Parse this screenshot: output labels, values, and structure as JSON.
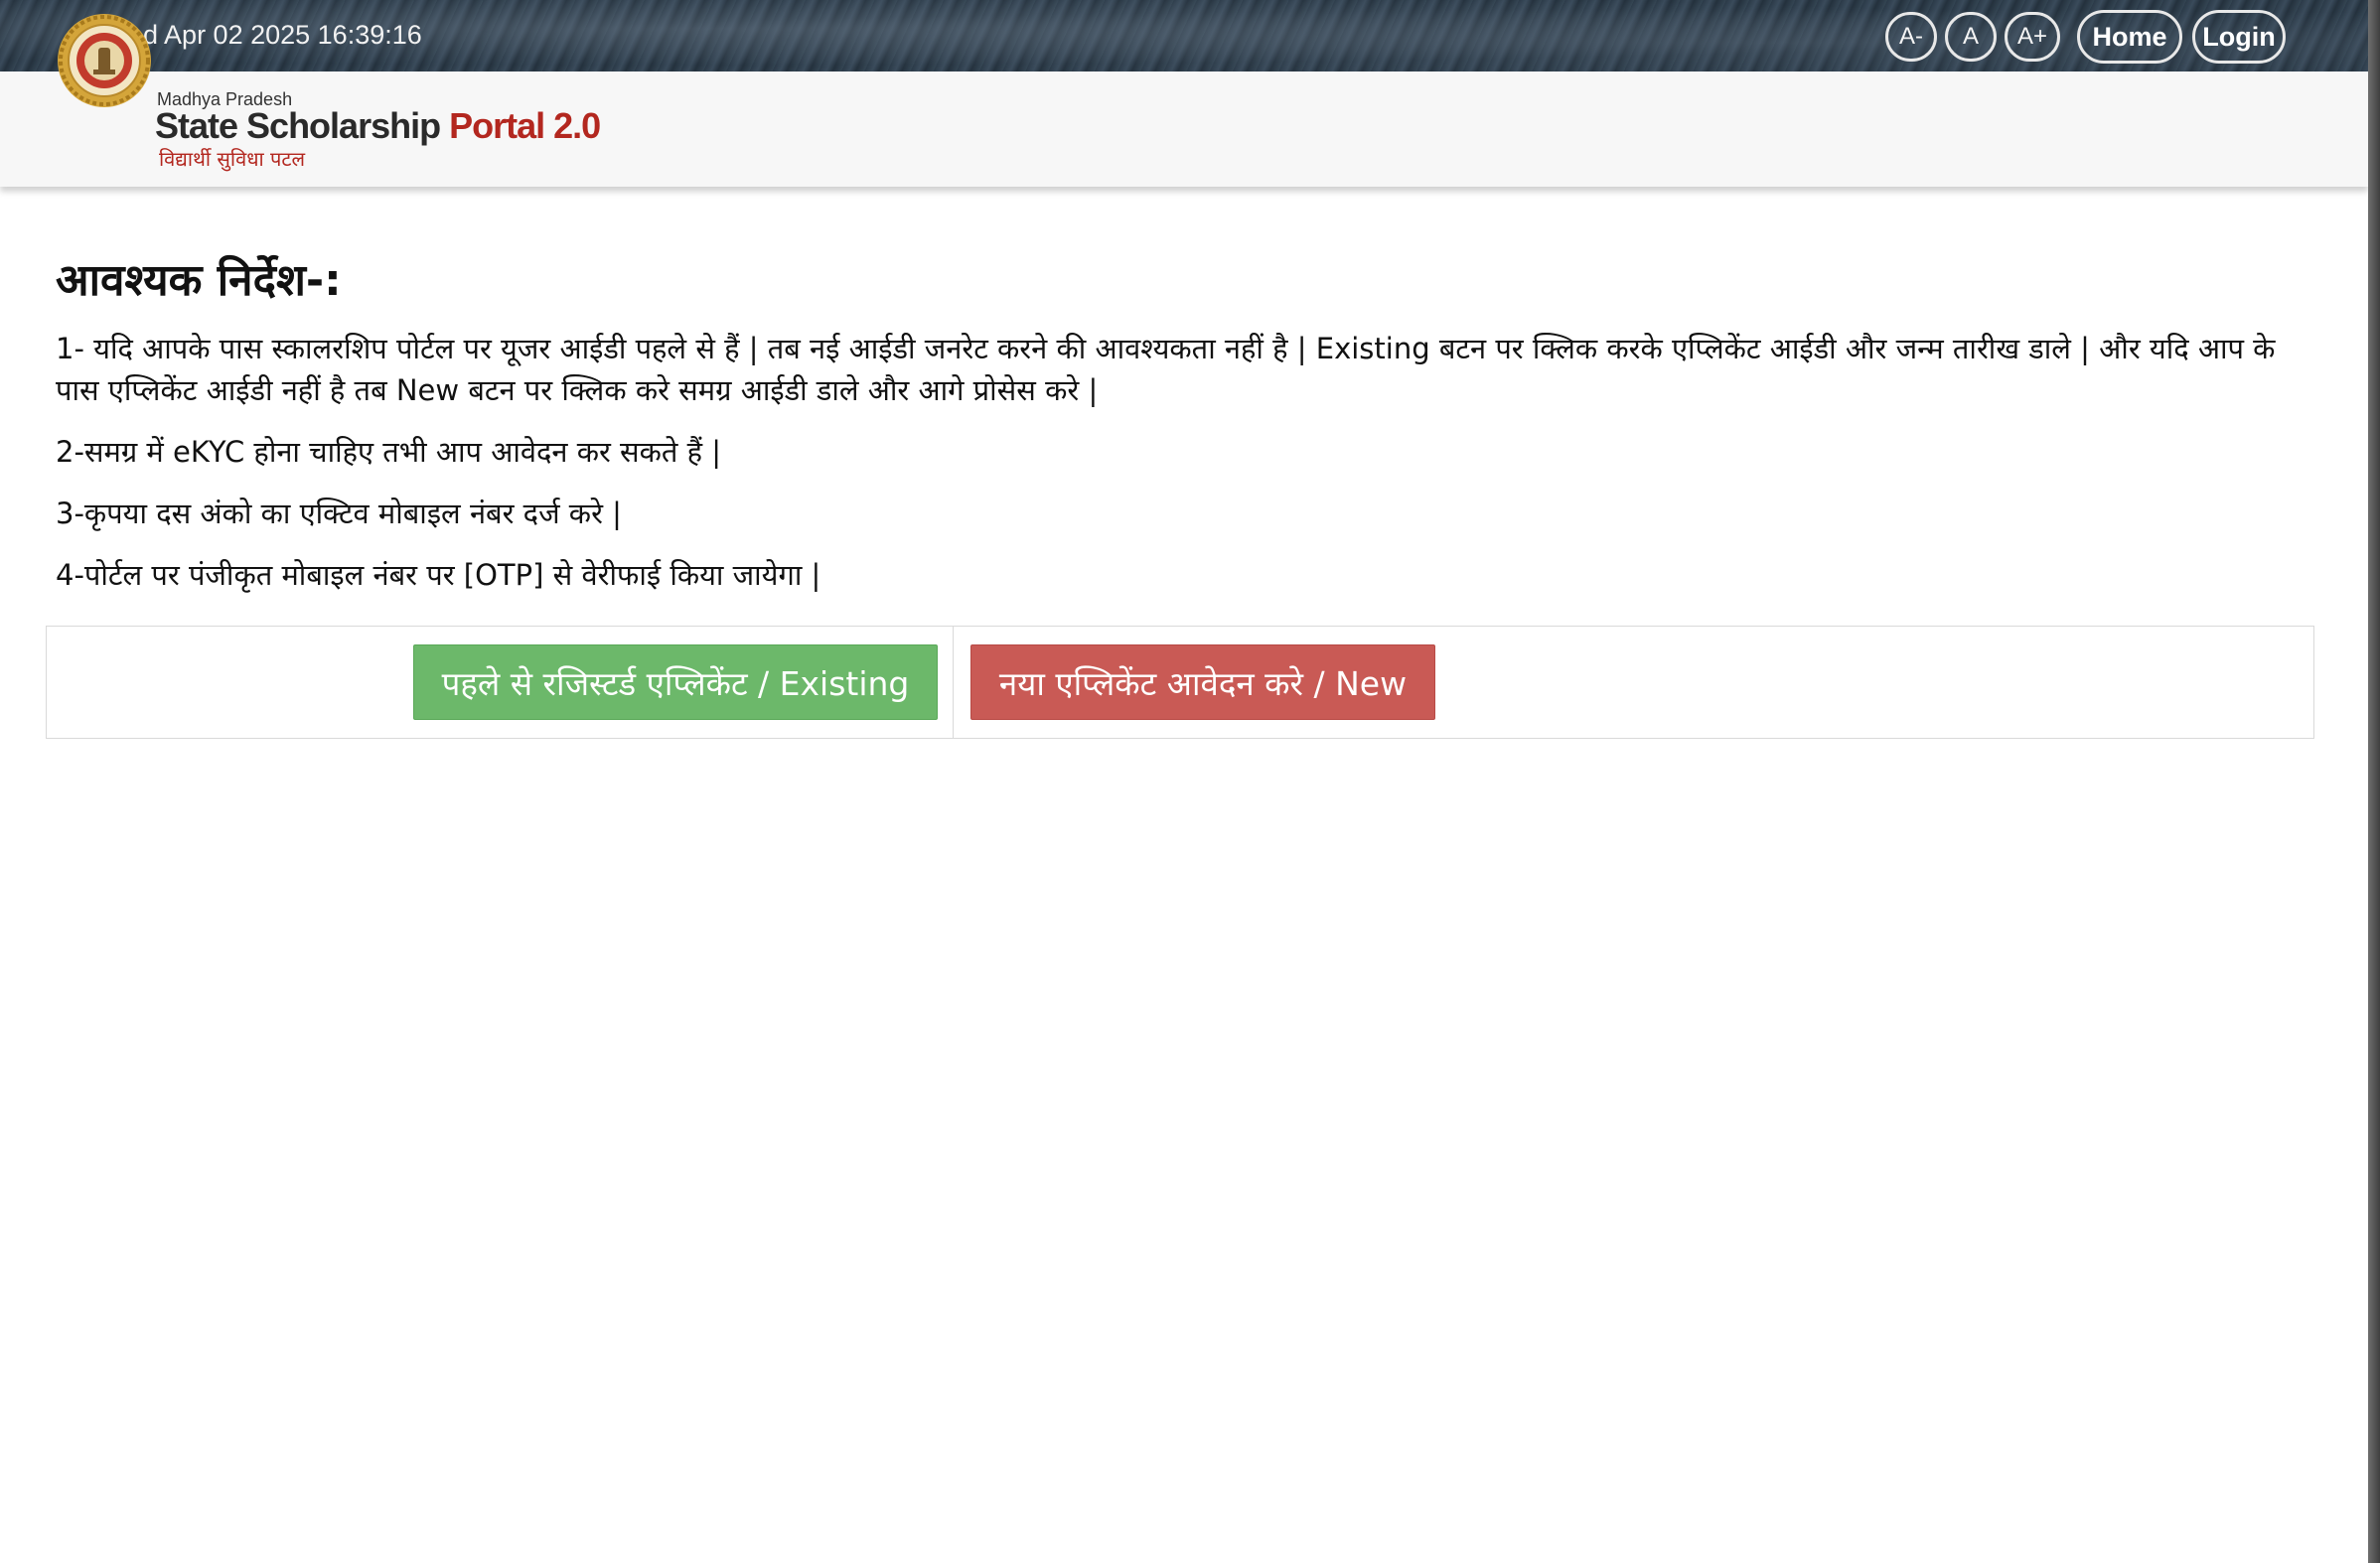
{
  "topbar": {
    "datetime": "Wed Apr 02 2025 16:39:16",
    "font_buttons": [
      "A-",
      "A",
      "A+"
    ],
    "home_label": "Home",
    "login_label": "Login"
  },
  "header": {
    "logo_small": "Madhya Pradesh",
    "logo_main": "State Scholarship",
    "logo_main_accent": "Portal 2.0",
    "logo_hindi": "विद्यार्थी सुविधा पटल",
    "colors": {
      "accent": "#b3271f"
    }
  },
  "instructions": {
    "heading": "आवश्यक निर्देश-:",
    "items": [
      "1- यदि आपके पास स्कालरशिप पोर्टल पर यूजर आईडी पहले से हैं | तब नई आईडी जनरेट करने की आवश्यकता नहीं है | Existing बटन पर क्लिक करके एप्लिकेंट आईडी और जन्म तारीख डाले | और यदि आप के पास एप्लिकेंट आईडी नहीं है तब New बटन पर क्लिक करे समग्र आईडी डाले और आगे प्रोसेस करे |",
      "2-समग्र में eKYC होना चाहिए तभी आप आवेदन कर सकते हैं |",
      "3-कृपया दस अंको का एक्टिव मोबाइल नंबर दर्ज करे |",
      "4-पोर्टल पर पंजीकृत मोबाइल नंबर पर [OTP] से वेरीफाई किया जायेगा |"
    ]
  },
  "actions": {
    "existing_label": "पहले से रजिस्टर्ड एप्लिकेंट / Existing",
    "new_label": "नया एप्लिकेंट आवेदन करे / New",
    "colors": {
      "existing": "#6cb86a",
      "new": "#c95a55"
    }
  }
}
